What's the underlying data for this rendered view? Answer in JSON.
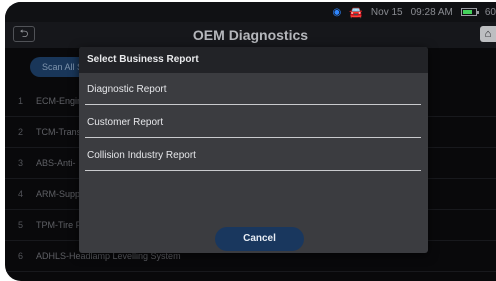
{
  "status_bar": {
    "date": "Nov 15",
    "time": "09:28 AM",
    "battery_text": "60",
    "icons": [
      "wifi-icon",
      "car-icon",
      "battery-icon"
    ]
  },
  "header": {
    "title": "OEM Diagnostics",
    "back_icon": "back-arrow-icon",
    "back_glyph": "⮌",
    "home_icon": "home-icon",
    "home_glyph": "⌂"
  },
  "scan_button": {
    "label": "Scan All S"
  },
  "modules": [
    {
      "num": "1",
      "label": "ECM-Engir"
    },
    {
      "num": "2",
      "label": "TCM-Trans"
    },
    {
      "num": "3",
      "label": "ABS-Anti-"
    },
    {
      "num": "4",
      "label": "ARM-Supp"
    },
    {
      "num": "5",
      "label": "TPM-Tire F"
    },
    {
      "num": "6",
      "label": "ADHLS-Headlamp Levelling System"
    }
  ],
  "dialog": {
    "title": "Select Business Report",
    "options": [
      "Diagnostic Report",
      "Customer Report",
      "Collision Industry Report"
    ],
    "cancel_label": "Cancel"
  },
  "colors": {
    "accent_blue": "#19375e",
    "background": "#0b0b0d",
    "dialog_bg": "#3b3c40",
    "battery_green": "#44d15b",
    "wifi_blue": "#2f86ff"
  }
}
